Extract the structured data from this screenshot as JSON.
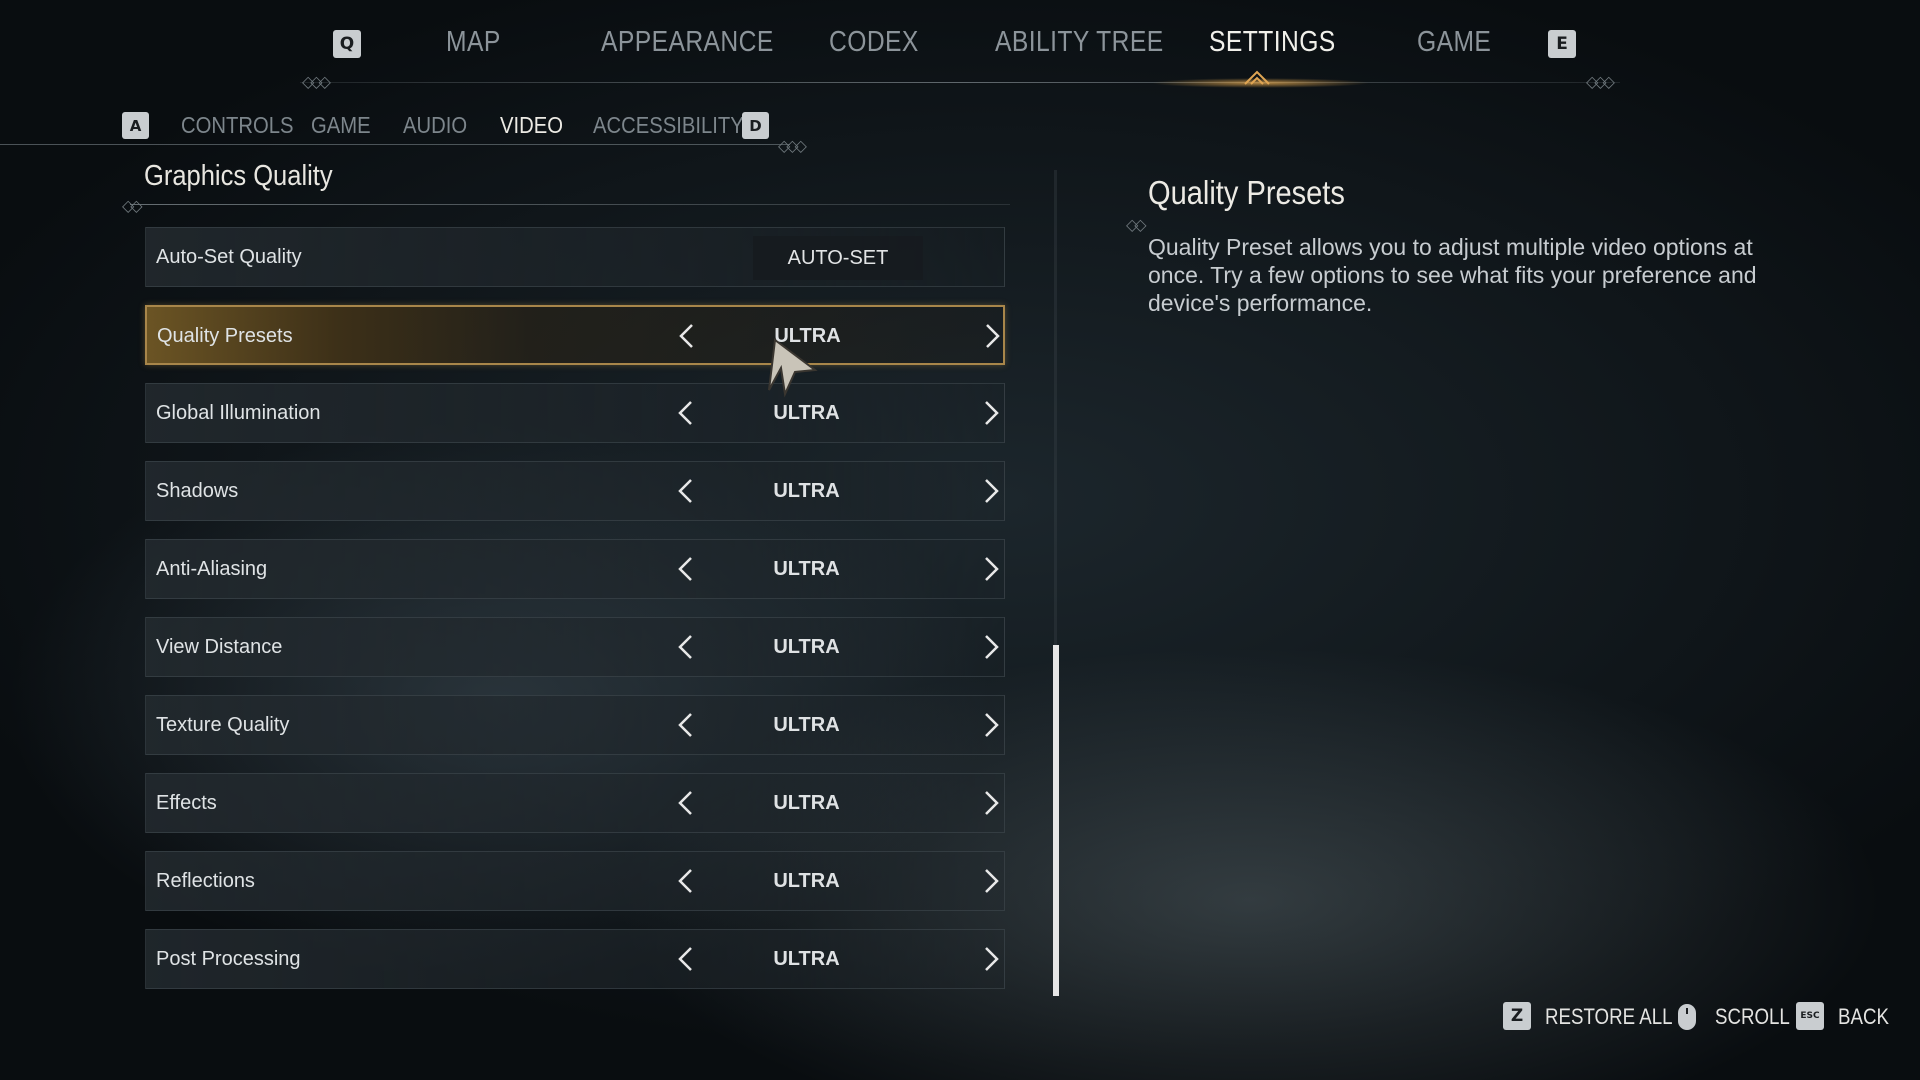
{
  "top_nav": {
    "left_key": "Q",
    "right_key": "E",
    "items": [
      {
        "label": "MAP"
      },
      {
        "label": "APPEARANCE"
      },
      {
        "label": "CODEX"
      },
      {
        "label": "ABILITY TREE"
      },
      {
        "label": "SETTINGS",
        "active": true
      },
      {
        "label": "GAME"
      }
    ]
  },
  "sub_nav": {
    "left_key": "A",
    "right_key": "D",
    "items": [
      {
        "label": "CONTROLS"
      },
      {
        "label": "GAME"
      },
      {
        "label": "AUDIO"
      },
      {
        "label": "VIDEO",
        "active": true
      },
      {
        "label": "ACCESSIBILITY"
      }
    ]
  },
  "section": {
    "title": "Graphics Quality"
  },
  "settings": [
    {
      "label": "Auto-Set Quality",
      "button": "AUTO-SET"
    },
    {
      "label": "Quality Presets",
      "value": "ULTRA",
      "selected": true
    },
    {
      "label": "Global Illumination",
      "value": "ULTRA"
    },
    {
      "label": "Shadows",
      "value": "ULTRA"
    },
    {
      "label": "Anti-Aliasing",
      "value": "ULTRA"
    },
    {
      "label": "View Distance",
      "value": "ULTRA"
    },
    {
      "label": "Texture Quality",
      "value": "ULTRA"
    },
    {
      "label": "Effects",
      "value": "ULTRA"
    },
    {
      "label": "Reflections",
      "value": "ULTRA"
    },
    {
      "label": "Post Processing",
      "value": "ULTRA"
    }
  ],
  "info": {
    "title": "Quality Presets",
    "body": "Quality Preset allows you to adjust multiple video options at once. Try a few options to see what fits your preference and device's performance."
  },
  "footer": {
    "restore_key": "Z",
    "restore_label": "RESTORE ALL",
    "scroll_label": "SCROLL",
    "back_key": "ESC",
    "back_label": "BACK"
  },
  "colors": {
    "accent": "#a8864a",
    "highlight": "#6b5424",
    "background": "#0e1418"
  }
}
